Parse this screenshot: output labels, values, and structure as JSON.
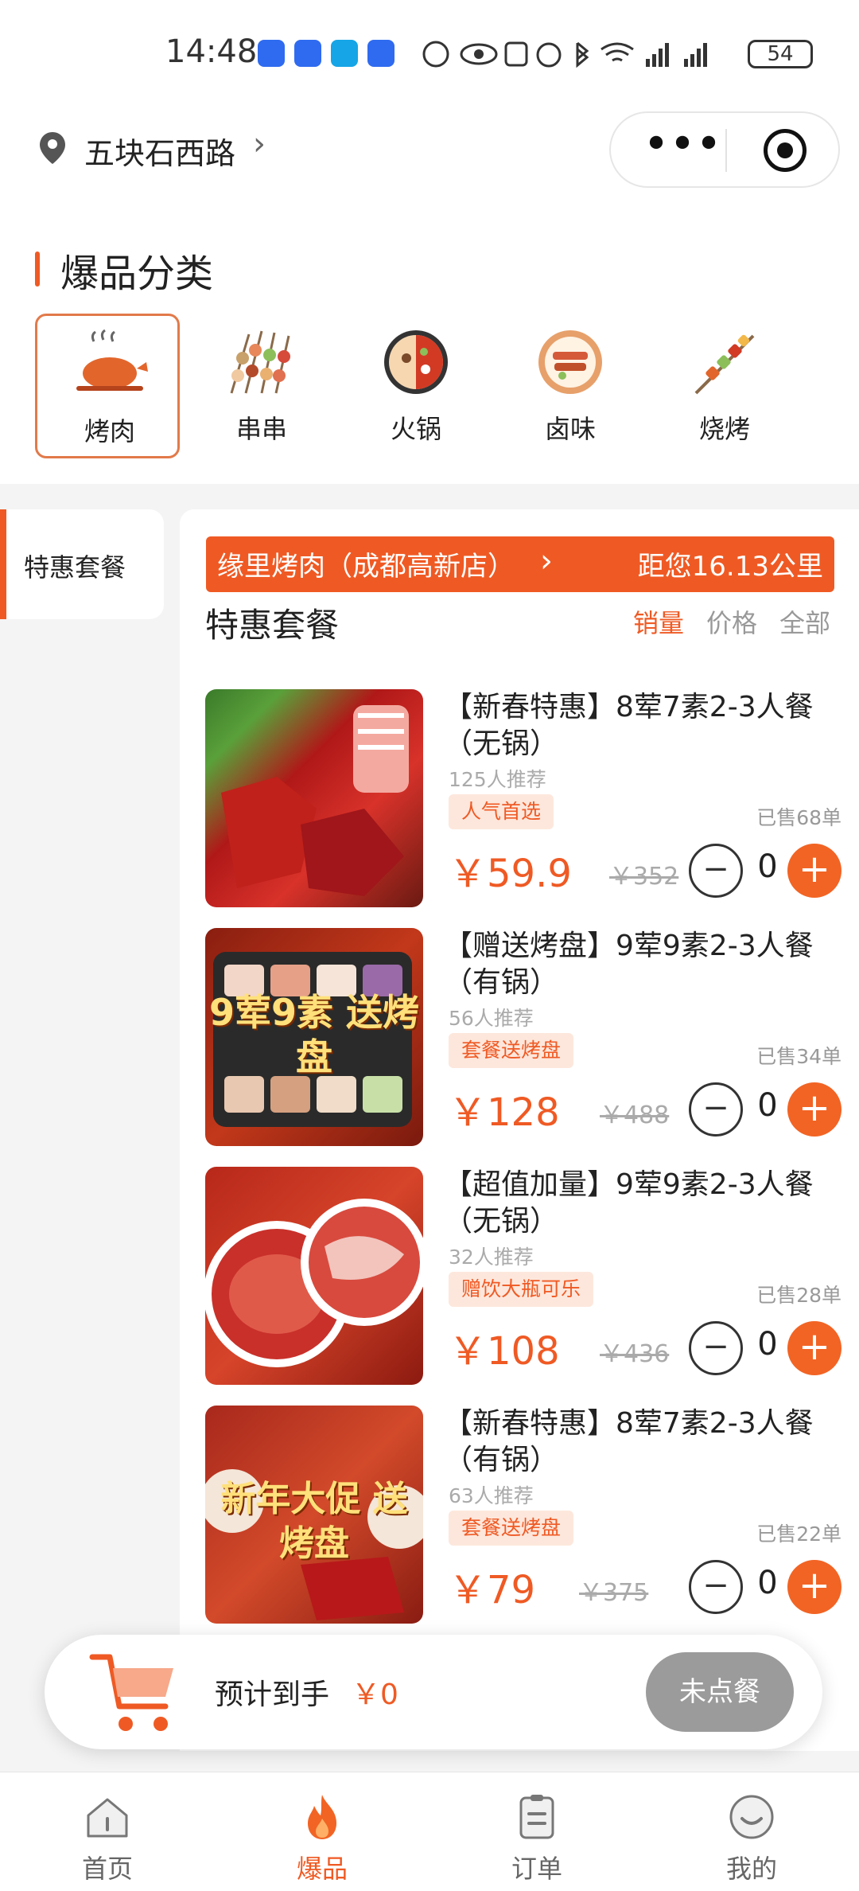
{
  "status_bar": {
    "time": "14:48",
    "app_icon_colors": [
      "#2f6bf0",
      "#2f6bf0",
      "#16a5e6",
      "#2f6bf0"
    ],
    "indicators": [
      "nfc-icon",
      "eye-icon",
      "n-icon",
      "alarm-icon",
      "bluetooth-icon",
      "wifi-icon",
      "5g-signal-icon",
      "4g-signal-icon"
    ],
    "battery": "54"
  },
  "header": {
    "location": "五块石西路",
    "capsule": {
      "more_icon": "more-icon",
      "close_icon": "target-icon"
    }
  },
  "categories": {
    "title": "爆品分类",
    "items": [
      {
        "label": "烤肉",
        "icon": "roast-chicken-icon",
        "selected": true
      },
      {
        "label": "串串",
        "icon": "skewers-icon",
        "selected": false
      },
      {
        "label": "火锅",
        "icon": "hotpot-icon",
        "selected": false
      },
      {
        "label": "卤味",
        "icon": "braised-icon",
        "selected": false
      },
      {
        "label": "烧烤",
        "icon": "bbq-icon",
        "selected": false
      }
    ]
  },
  "sidebar": {
    "items": [
      {
        "label": "特惠套餐",
        "active": true
      }
    ]
  },
  "store": {
    "name": "缘里烤肉（成都高新店）",
    "distance": "距您16.13公里"
  },
  "section": {
    "title": "特惠套餐",
    "sort": [
      {
        "label": "销量",
        "active": true
      },
      {
        "label": "价格",
        "active": false
      },
      {
        "label": "全部",
        "active": false
      }
    ]
  },
  "products": [
    {
      "name": "【新春特惠】8荤7素2-3人餐（无锅）",
      "recommend": "125人推荐",
      "tag": "人气首选",
      "sold": "已售68单",
      "price": "￥59.9",
      "original": "￥352",
      "qty": "0"
    },
    {
      "name": "【赠送烤盘】9荤9素2-3人餐（有锅）",
      "recommend": "56人推荐",
      "tag": "套餐送烤盘",
      "sold": "已售34单",
      "price": "￥128",
      "original": "￥488",
      "qty": "0",
      "image_text": "9荤9素 送烤盘"
    },
    {
      "name": "【超值加量】9荤9素2-3人餐（无锅）",
      "recommend": "32人推荐",
      "tag": "赠饮大瓶可乐",
      "sold": "已售28单",
      "price": "￥108",
      "original": "￥436",
      "qty": "0"
    },
    {
      "name": "【新春特惠】8荤7素2-3人餐（有锅）",
      "recommend": "63人推荐",
      "tag": "套餐送烤盘",
      "sold": "已售22单",
      "price": "￥79",
      "original": "￥375",
      "qty": "0",
      "image_text": "新年大促 送烤盘"
    }
  ],
  "controls": {
    "minus": "−",
    "plus": "+"
  },
  "cart": {
    "label": "预计到手",
    "total": "￥0",
    "button": "未点餐"
  },
  "tabbar": [
    {
      "label": "首页",
      "icon": "home-icon",
      "active": false
    },
    {
      "label": "爆品",
      "icon": "flame-icon",
      "active": true
    },
    {
      "label": "订单",
      "icon": "order-icon",
      "active": false
    },
    {
      "label": "我的",
      "icon": "profile-icon",
      "active": false
    }
  ],
  "colors": {
    "accent": "#ef5a24",
    "tag_bg": "#fde7dc",
    "disabled_button": "#9b9b9b"
  }
}
